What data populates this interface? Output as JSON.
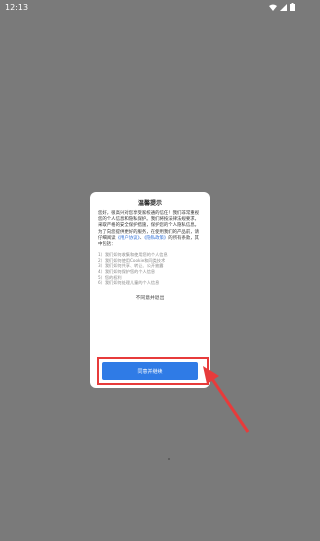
{
  "status_bar": {
    "time": "12:13",
    "icons": [
      "wifi-icon",
      "signal-icon",
      "battery-icon"
    ]
  },
  "dialog": {
    "title": "温馨提示",
    "intro_part1": "您好，很高兴对您享受家校通的信任！我们非常重视您的个人信息和隐私保护。我们将按法律法规要求，采取严格的安全保护措施，保护您的个人隐私信息。为了向您提供更好的服务，在使用我们的产品前，请仔细阅读",
    "link_user_agreement": "《用户协议》",
    "intro_and": "、",
    "link_privacy_policy": "《隐私政策》",
    "intro_part2": "的所有条款，其中包括：",
    "list_items": [
      "1）我们如何收集和使用您的个人信息",
      "2）我们如何使用Cookie和同类技术",
      "3）我们如何共享、转让、公开披露",
      "4）我们如何保护您的个人信息",
      "5）您的权利",
      "6）我们如何处理儿童的个人信息"
    ],
    "decline_label": "不同意并退出",
    "agree_label": "同意并继续"
  },
  "colors": {
    "overlay": "#7a7a7a",
    "dialog_bg": "#ffffff",
    "link": "#2f6fd6",
    "button": "#2f7be6",
    "annotation": "#e73b3b"
  }
}
